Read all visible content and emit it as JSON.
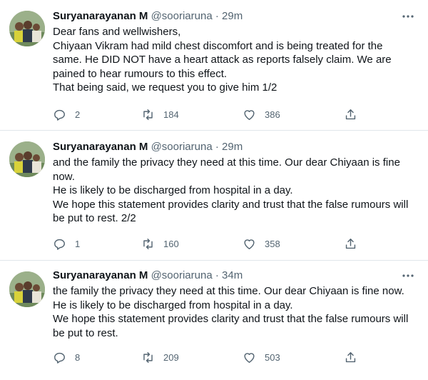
{
  "tweets": [
    {
      "name": "Suryanarayanan M",
      "handle": "@sooriaruna",
      "dot": "·",
      "time": "29m",
      "lines": [
        "Dear fans and wellwishers,",
        "Chiyaan Vikram had mild chest discomfort and is being treated for the",
        "same. He DID NOT have a heart attack as reports falsely claim. We are",
        "pained to hear rumours to this effect.",
        "That being said, we request you to give him 1/2"
      ],
      "replies": "2",
      "retweets": "184",
      "likes": "386"
    },
    {
      "name": "Suryanarayanan M",
      "handle": "@sooriaruna",
      "dot": "·",
      "time": "29m",
      "lines": [
        "and the family the privacy they need at this time. Our dear Chiyaan is fine",
        "now.",
        "He is likely to be discharged from hospital in a day.",
        "We hope this statement provides clarity and trust that the false rumours will",
        "be put to rest. 2/2"
      ],
      "replies": "1",
      "retweets": "160",
      "likes": "358"
    },
    {
      "name": "Suryanarayanan M",
      "handle": "@sooriaruna",
      "dot": "·",
      "time": "34m",
      "lines": [
        "the family the privacy they need at this time. Our dear Chiyaan is fine now.",
        "He is likely to be discharged from hospital in a day.",
        "We hope this statement provides clarity and trust that the false rumours will",
        "be put to rest."
      ],
      "replies": "8",
      "retweets": "209",
      "likes": "503"
    }
  ],
  "icons": {
    "reply": "reply-icon",
    "retweet": "retweet-icon",
    "like": "heart-icon",
    "share": "share-icon",
    "more": "more-icon"
  },
  "colors": {
    "text": "#0f1419",
    "muted": "#536471",
    "divider": "#e1e6ea"
  }
}
